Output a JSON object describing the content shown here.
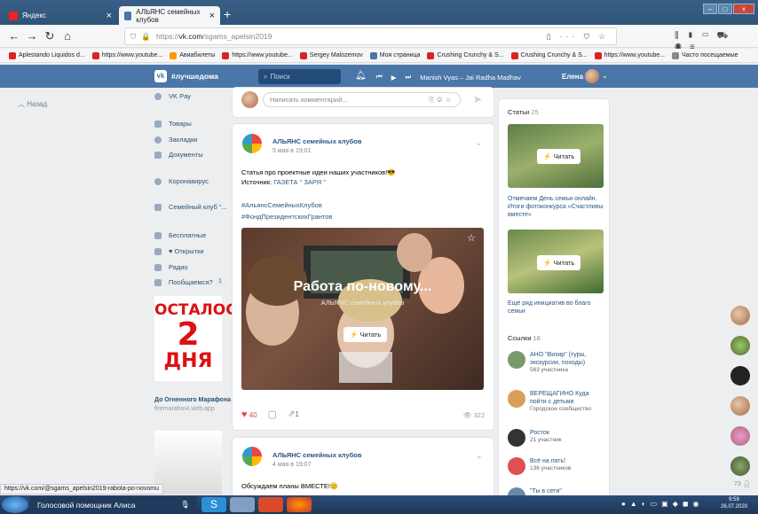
{
  "browser": {
    "tabs": [
      {
        "title": "Яндекс",
        "active": false
      },
      {
        "title": "АЛЬЯНС семейных клубов",
        "active": true
      }
    ],
    "new_tab": "+",
    "url_prefix": "https://",
    "url_domain": "vk.com",
    "url_path": "/sgams_apelsin2019",
    "bookmarks": [
      "Aplestando Liquidos d...",
      "https://www.youtube...",
      "Авиабилеты",
      "https://www.youtube...",
      "Sergey Malozemov",
      "Моя страница",
      "Crushing Crunchy & S...",
      "Crushing Crunchy & S...",
      "https://www.youtube...",
      "Часто посещаемые"
    ]
  },
  "vk": {
    "header": {
      "tag": "#лучшедома",
      "search_placeholder": "Поиск",
      "player_track": "Manish Vyas – Jai Radha Madhav",
      "user": "Елена"
    },
    "back_label": "Назад",
    "menu": [
      "VK Pay",
      "Товары",
      "Закладки",
      "Документы",
      "Коронавирус",
      "Семейный клуб \"...",
      "Бесплатные",
      "♥ Открытки",
      "Радио",
      "Пообщаемся?"
    ],
    "badge": "1",
    "ad": {
      "line1": "ОСТАЛОСЬ",
      "line2": "2",
      "line3": "ДНЯ",
      "title": "До Огненного Марафона",
      "url": "firemarafon4.web.app"
    },
    "comment_placeholder": "Написать комментарий...",
    "post1": {
      "group": "АЛЬЯНС семейных клубов",
      "date": "5 мая в 19:01",
      "text1": "Статья про проектные идеи наших участников!😎",
      "text2_label": "Источник:",
      "text2_link": "ГАЗЕТА \" ЗАРЯ \"",
      "hashtag1": "#АльянсСемейныхКлубов",
      "hashtag2": "#ФондПрезидентскихГрантов",
      "article_title": "Работа по-новому...",
      "article_sub": "АЛЬЯНС семейных клубов",
      "read_label": "Читать",
      "likes": "40",
      "shares": "1",
      "views": "322"
    },
    "post2": {
      "group": "АЛЬЯНС семейных клубов",
      "date": "4 мая в 19:07",
      "text": "Обсуждаем планы ВМЕСТЕ!😊"
    },
    "right": {
      "articles_title": "Статьи",
      "articles_count": "25",
      "read_label": "Читать",
      "article1": "Отмечаем День семьи онлайн. Итоги фотоконкурса «Счастливы вместе»",
      "article2": "Ещё ряд инициатив во благо семьи",
      "links_title": "Ссылки",
      "links_count": "18",
      "links": [
        {
          "name": "АНО \"Визир\" (туры, экскурсии, походы)",
          "sub": "563 участника"
        },
        {
          "name": "ВЕРЕЩАГИНО Куда пойти с детьми",
          "sub": "Городское сообщество"
        },
        {
          "name": "Росток",
          "sub": "21 участник"
        },
        {
          "name": "Всё на пять!",
          "sub": "136 участников"
        },
        {
          "name": "\"Ты в сети\"",
          "sub": ""
        }
      ],
      "online_count": "73"
    }
  },
  "status_url": "https://vk.com/@sgams_apelsin2019-rabota-po-novomu",
  "taskbar": {
    "assistant": "Голосовой помощник Алиса",
    "time": "9:59",
    "date": "26.07.2020"
  }
}
